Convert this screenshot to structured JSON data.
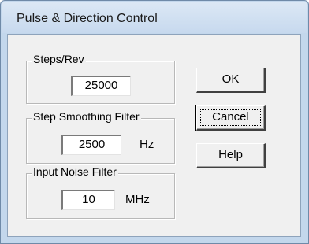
{
  "window": {
    "title": "Pulse & Direction Control"
  },
  "groups": {
    "steps_rev": {
      "label": "Steps/Rev",
      "value": "25000"
    },
    "smoothing": {
      "label": "Step Smoothing Filter",
      "value": "2500",
      "unit": "Hz"
    },
    "noise": {
      "label": "Input Noise Filter",
      "value": "10",
      "unit": "MHz"
    }
  },
  "buttons": {
    "ok": "OK",
    "cancel": "Cancel",
    "help": "Help"
  }
}
